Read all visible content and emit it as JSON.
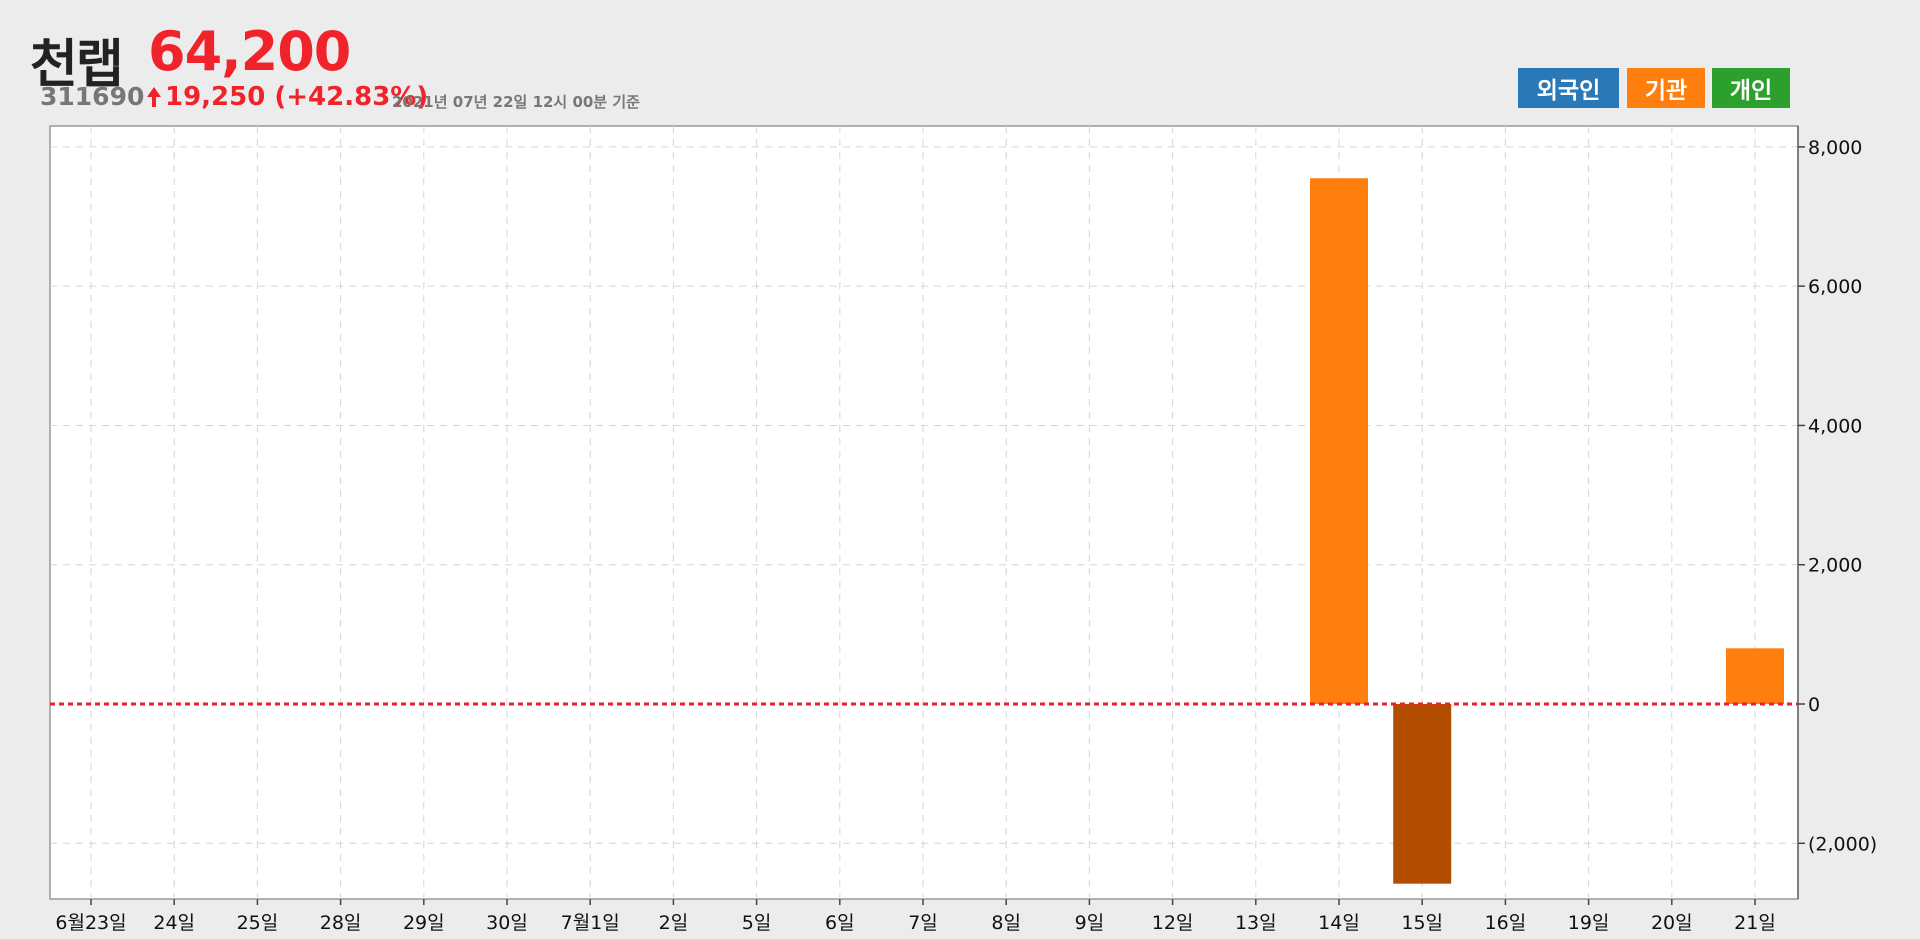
{
  "header": {
    "stock_name": "천랩",
    "price": "64,200",
    "code": "311690",
    "change": "19,250 (+42.83%)",
    "timestamp": "2021년 07년 22일 12시 00분 기준"
  },
  "legend": [
    {
      "label": "외국인",
      "color": "#2a78b6"
    },
    {
      "label": "기관",
      "color": "#ff7f0e"
    },
    {
      "label": "개인",
      "color": "#2ca02c"
    }
  ],
  "colors": {
    "up": "#f0222a",
    "positive_bar": "#ff7f0e",
    "negative_bar": "#b24d00",
    "zero_line": "#e8212a"
  },
  "chart_data": {
    "type": "bar",
    "categories": [
      "6월23일",
      "24일",
      "25일",
      "28일",
      "29일",
      "30일",
      "7월1일",
      "2일",
      "5일",
      "6일",
      "7일",
      "8일",
      "9일",
      "12일",
      "13일",
      "14일",
      "15일",
      "16일",
      "19일",
      "20일",
      "21일"
    ],
    "series": [
      {
        "values": [
          0,
          0,
          0,
          0,
          0,
          0,
          0,
          0,
          0,
          0,
          0,
          0,
          0,
          0,
          0,
          7550,
          -2580,
          0,
          0,
          0,
          800
        ]
      }
    ],
    "ylim": [
      -2800,
      8300
    ],
    "yticks": [
      8000,
      6000,
      4000,
      2000,
      0,
      -2000
    ],
    "ytick_labels": [
      "8,000",
      "6,000",
      "4,000",
      "2,000",
      "0",
      "(2,000)"
    ],
    "grid": true,
    "y_axis_side": "right"
  }
}
